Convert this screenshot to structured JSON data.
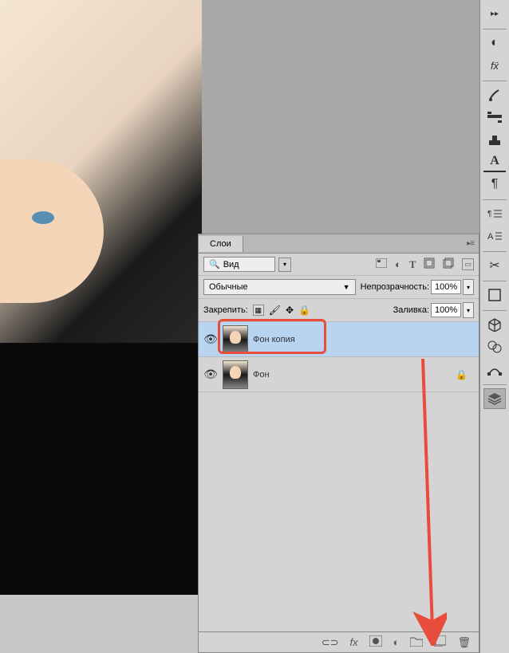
{
  "panel": {
    "tab_label": "Слои",
    "search_label": "Вид",
    "blend_mode": "Обычные",
    "opacity_label": "Непрозрачность:",
    "opacity_value": "100%",
    "lock_label": "Закрепить:",
    "fill_label": "Заливка:",
    "fill_value": "100%"
  },
  "layers": [
    {
      "name": "Фон копия",
      "selected": true,
      "locked": false
    },
    {
      "name": "Фон",
      "selected": false,
      "locked": true
    }
  ],
  "row_icons": {
    "image": "image-icon",
    "adjust": "circle-half-icon",
    "text": "T",
    "shape": "shape-icon",
    "smart": "smart-icon"
  },
  "sidebar_icons": [
    "menu",
    "circle-half",
    "fx",
    "brush",
    "swap",
    "stamp",
    "text-a",
    "paragraph",
    "align-para",
    "grid",
    "scissors",
    "square",
    "cube",
    "overlap",
    "shape3",
    "layers"
  ]
}
